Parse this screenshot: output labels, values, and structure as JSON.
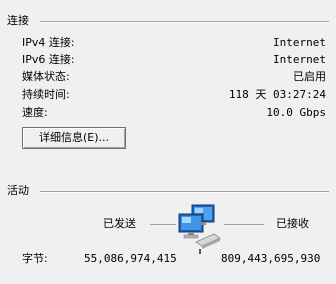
{
  "connection": {
    "title": "连接",
    "rows": [
      {
        "label": "IPv4 连接:",
        "value": "Internet"
      },
      {
        "label": "IPv6 连接:",
        "value": "Internet"
      },
      {
        "label": "媒体状态:",
        "value": "已启用"
      },
      {
        "label": "持续时间:",
        "value": "118 天 03:27:24"
      },
      {
        "label": "速度:",
        "value": "10.0 Gbps"
      }
    ],
    "details_button": "详细信息(E)..."
  },
  "activity": {
    "title": "活动",
    "sent_label": "已发送",
    "received_label": "已接收",
    "bytes_label": "字节:",
    "bytes_sent": "55,086,974,415",
    "bytes_received": "809,443,695,930",
    "network_icon": "network-computers-icon"
  }
}
